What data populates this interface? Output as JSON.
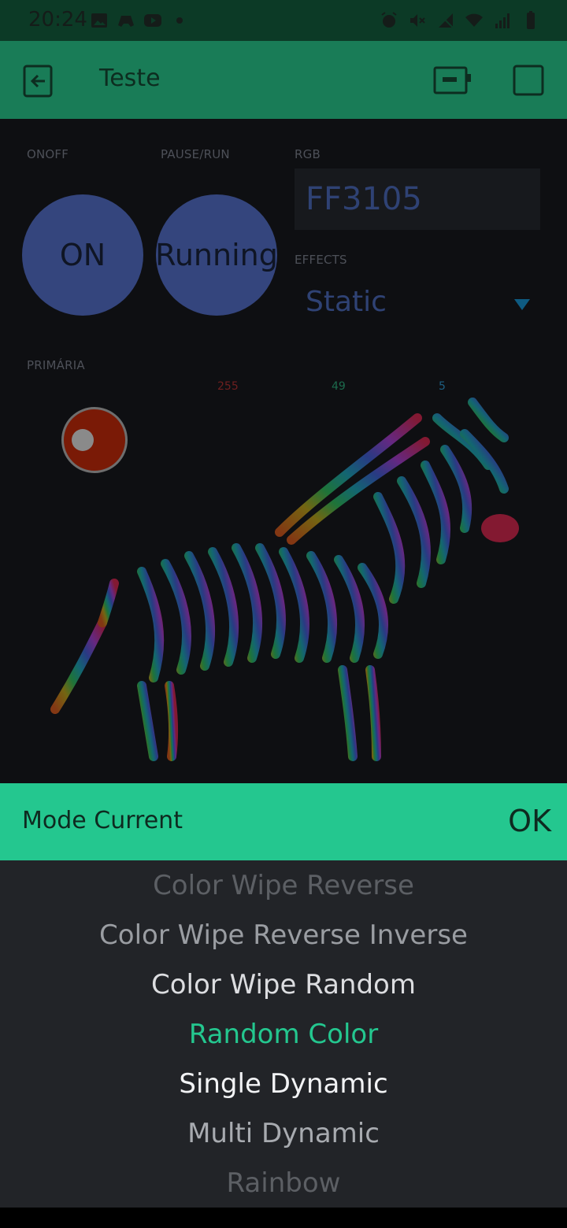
{
  "status_bar": {
    "time": "20:24",
    "left_icons": [
      "gallery-icon",
      "game-controller-icon",
      "youtube-icon",
      "dot-icon"
    ],
    "right_icons": [
      "alarm-icon",
      "mute-icon",
      "no-signal-icon",
      "wifi-icon",
      "signal-icon",
      "battery-icon"
    ]
  },
  "app_bar": {
    "title": "Teste",
    "icons": [
      "back-icon",
      "device-icon",
      "square-icon"
    ]
  },
  "widgets": {
    "onoff": {
      "label": "ONOFF",
      "value": "ON"
    },
    "pause_run": {
      "label": "PAUSE/RUN",
      "value": "Running"
    },
    "rgb": {
      "label": "RGB",
      "value": "FF3105"
    },
    "effects": {
      "label": "EFFECTS",
      "value": "Static"
    },
    "primaria": {
      "label": "PRIMÁRIA",
      "r": "255",
      "g": "49",
      "b": "5",
      "color": "#ff3105"
    }
  },
  "picker": {
    "title": "Mode Current",
    "ok_label": "OK",
    "options": [
      "Color Wipe Reverse",
      "Color Wipe Reverse Inverse",
      "Color Wipe Random",
      "Random Color",
      "Single Dynamic",
      "Multi Dynamic",
      "Rainbow"
    ],
    "selected": "Random Color",
    "accent_color": "#24c78f"
  }
}
